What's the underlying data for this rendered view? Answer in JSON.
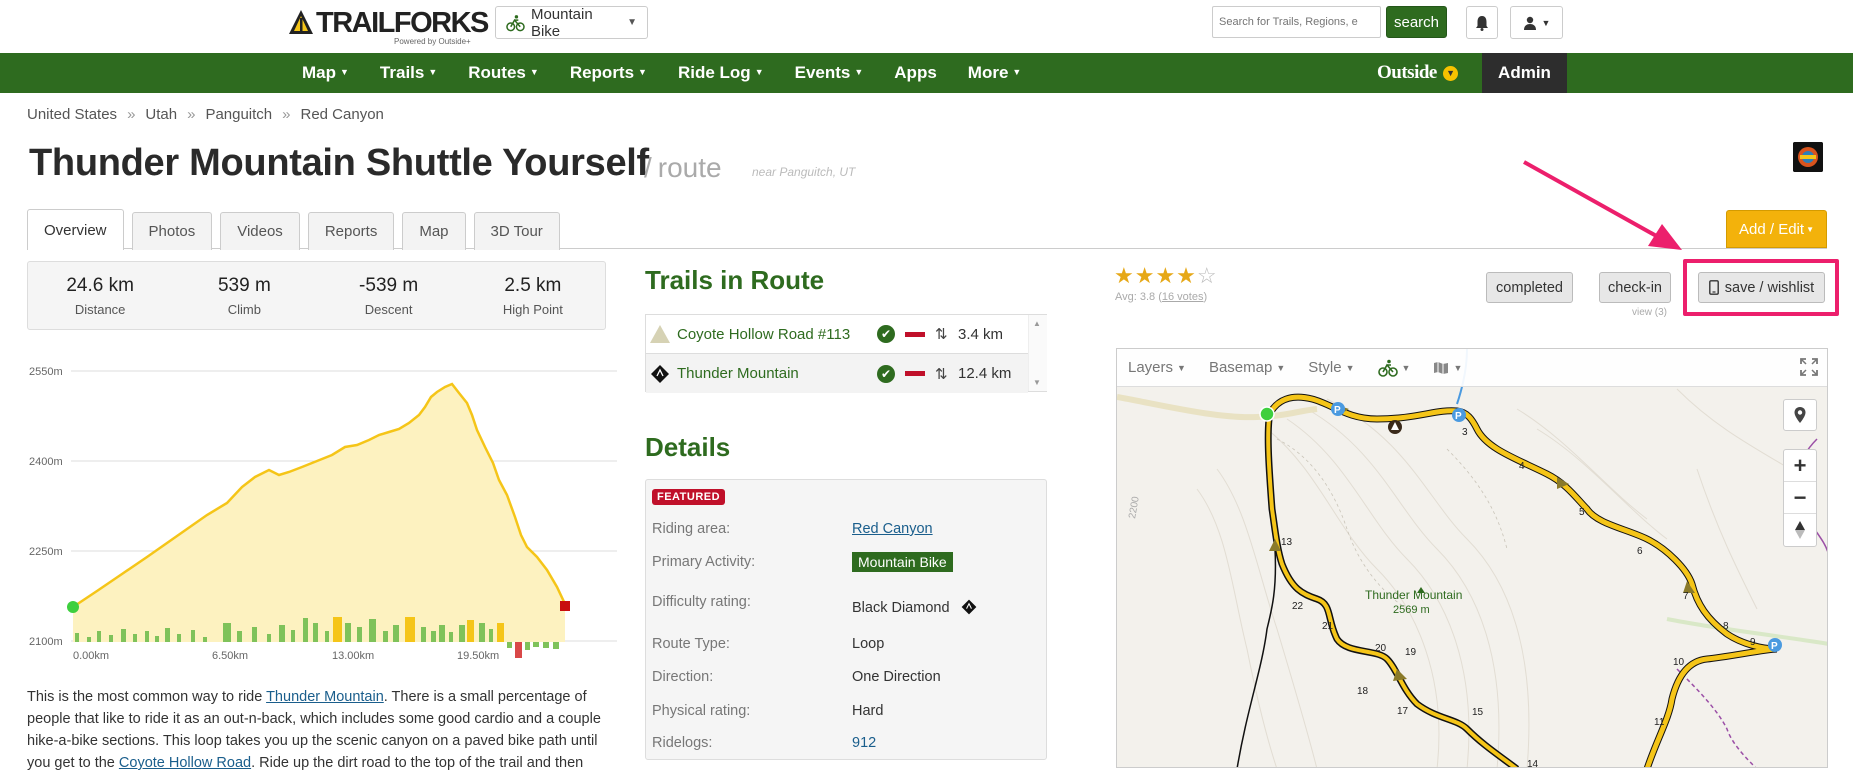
{
  "header": {
    "logo_text": "TRAILFORKS",
    "logo_sub": "Powered by Outside+",
    "activity": "Mountain Bike",
    "search_placeholder": "Search for Trails, Regions, e",
    "search_button": "search"
  },
  "nav": {
    "items": [
      {
        "label": "Map",
        "caret": true
      },
      {
        "label": "Trails",
        "caret": true
      },
      {
        "label": "Routes",
        "caret": true
      },
      {
        "label": "Reports",
        "caret": true
      },
      {
        "label": "Ride Log",
        "caret": true
      },
      {
        "label": "Events",
        "caret": true
      },
      {
        "label": "Apps",
        "caret": false
      },
      {
        "label": "More",
        "caret": true
      }
    ],
    "outside_label": "Outside",
    "admin_label": "Admin"
  },
  "breadcrumb": [
    "United States",
    "Utah",
    "Panguitch",
    "Red Canyon"
  ],
  "page": {
    "title": "Thunder Mountain Shuttle Yourself",
    "type": "route",
    "near": "near Panguitch, UT"
  },
  "tabs": [
    "Overview",
    "Photos",
    "Videos",
    "Reports",
    "Map",
    "3D Tour"
  ],
  "add_edit": "Add / Edit",
  "stats": [
    {
      "value": "24.6 km",
      "label": "Distance"
    },
    {
      "value": "539 m",
      "label": "Climb"
    },
    {
      "value": "-539 m",
      "label": "Descent"
    },
    {
      "value": "2.5 km",
      "label": "High Point"
    }
  ],
  "profile": {
    "y_labels": [
      "2550m",
      "2400m",
      "2250m",
      "2100m"
    ],
    "x_labels": [
      "0.00km",
      "6.50km",
      "13.00km",
      "19.50km"
    ]
  },
  "description": {
    "p1": "This is the most common way to ride ",
    "link1": "Thunder Mountain",
    "p2": ". There is a small percentage of people that like to ride it as an out-n-back, which includes some good cardio and a couple hike-a-bike sections. This loop takes you up the scenic canyon on a paved bike path until you get to the ",
    "link2": "Coyote Hollow Road",
    "p3": ". Ride up the dirt road to the top of the trail and then"
  },
  "trails_in_route": {
    "title": "Trails in Route",
    "items": [
      {
        "name": "Coyote Hollow Road #113",
        "distance": "3.4 km",
        "difficulty": "easy"
      },
      {
        "name": "Thunder Mountain",
        "distance": "12.4 km",
        "difficulty": "black-diamond"
      }
    ]
  },
  "details": {
    "title": "Details",
    "featured": "FEATURED",
    "rows": [
      {
        "key": "Riding area:",
        "value": "Red Canyon"
      },
      {
        "key": "Primary Activity:",
        "value": "Mountain Bike"
      },
      {
        "key": "Difficulty rating:",
        "value": "Black Diamond"
      },
      {
        "key": "Route Type:",
        "value": "Loop"
      },
      {
        "key": "Direction:",
        "value": "One Direction"
      },
      {
        "key": "Physical rating:",
        "value": "Hard"
      },
      {
        "key": "Ridelogs:",
        "value": "912"
      }
    ]
  },
  "rating": {
    "stars_filled": "★★★★",
    "stars_empty": "☆",
    "avg": "Avg: 3.8 (",
    "votes": "16 votes",
    "avg_end": ")"
  },
  "actions": {
    "completed": "completed",
    "checkin": "check-in",
    "view": "view (3)",
    "save": "save / wishlist"
  },
  "map": {
    "layers": "Layers",
    "basemap": "Basemap",
    "style": "Style",
    "peak_name": "Thunder Mountain",
    "peak_elev": "2569 m",
    "contour": "2200",
    "markers": [
      "3",
      "4",
      "5",
      "6",
      "7",
      "8",
      "9",
      "10",
      "11",
      "13",
      "14",
      "15",
      "17",
      "18",
      "19",
      "20",
      "21",
      "22"
    ]
  },
  "colors": {
    "green": "#2e6b1f",
    "yellow": "#f5c518",
    "highlight": "#ec1f6c"
  }
}
